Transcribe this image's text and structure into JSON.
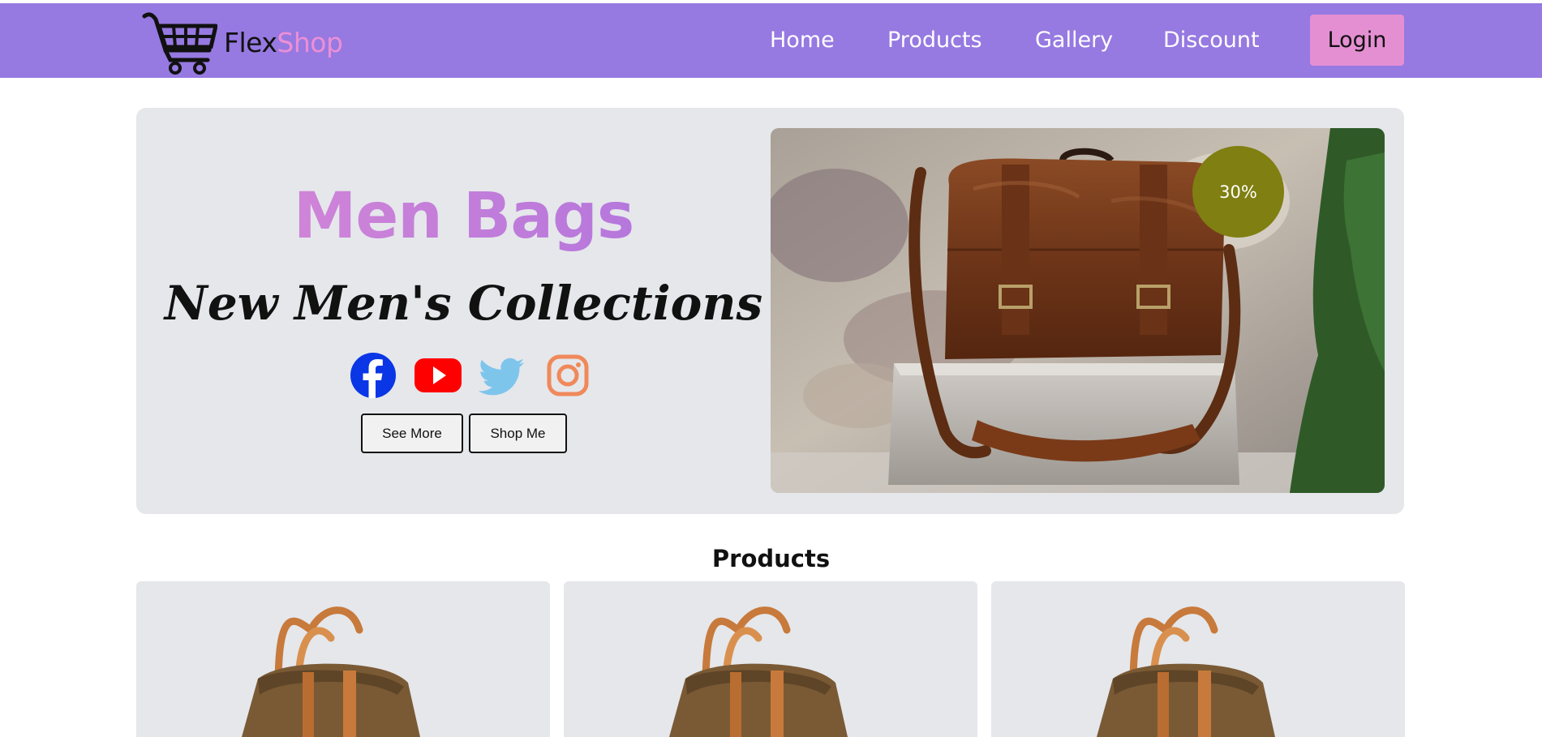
{
  "brand": {
    "part1": "Flex",
    "part2": "Shop",
    "logo_icon": "cart-icon",
    "accent": "#ec8fd6"
  },
  "nav": {
    "background": "#9679e1",
    "links": [
      "Home",
      "Products",
      "Gallery",
      "Discount"
    ],
    "login_label": "Login",
    "login_color": "#e58fd3"
  },
  "hero": {
    "title": "Men Bags",
    "subtitle": "New Men's Collections",
    "socials": [
      "facebook-icon",
      "youtube-icon",
      "twitter-icon",
      "instagram-icon"
    ],
    "buttons": {
      "see_more": "See More",
      "shop_me": "Shop Me"
    },
    "discount": "30%",
    "discount_color": "#7f7f12",
    "image": "leather-messenger-bag-photo"
  },
  "products_section": {
    "title": "Products",
    "cards": [
      {
        "image": "duffel-bag-photo"
      },
      {
        "image": "duffel-bag-photo"
      },
      {
        "image": "duffel-bag-photo"
      }
    ]
  }
}
